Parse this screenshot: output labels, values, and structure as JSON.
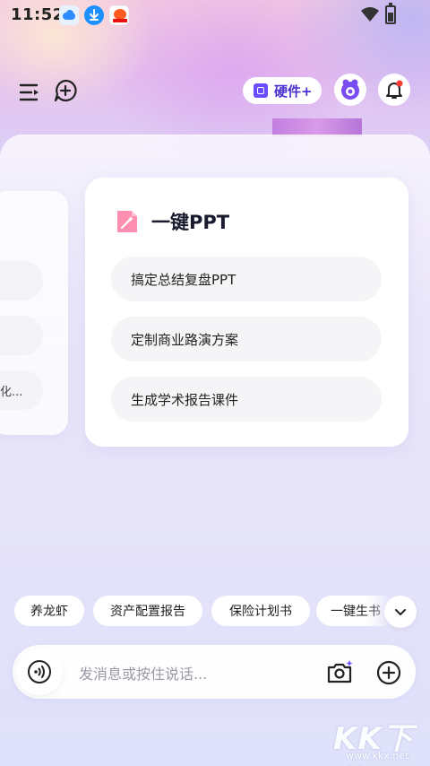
{
  "status_bar": {
    "time": "11:52",
    "icons": [
      "cloud-notification-icon",
      "download-notification-icon",
      "app-notification-icon",
      "wifi-icon",
      "battery-icon"
    ]
  },
  "header": {
    "hardware_button_label": "硬件+",
    "icons": [
      "menu-icon",
      "new-chat-icon",
      "mascot-icon",
      "bell-icon"
    ],
    "accent_color": "#4b2fd1"
  },
  "left_card": {
    "partial_items": [
      "",
      "",
      "化..."
    ]
  },
  "main_card": {
    "title": "一键PPT",
    "suggestions": [
      "搞定总结复盘PPT",
      "定制商业路演方案",
      "生成学术报告课件"
    ]
  },
  "quick_chips": [
    "养龙虾",
    "资产配置报告",
    "保险计划书",
    "一键生书"
  ],
  "input": {
    "placeholder": "发消息或按住说话..."
  },
  "watermark": {
    "text": "KK下载",
    "url": "www.kkx.net"
  }
}
